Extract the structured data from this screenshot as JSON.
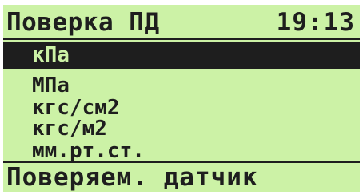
{
  "header": {
    "title": "Поверка ПД",
    "time": "19:13"
  },
  "menu": {
    "items": [
      {
        "label": "кПа",
        "selected": true
      },
      {
        "label": "МПа",
        "selected": false
      },
      {
        "label": "кгс/см2",
        "selected": false
      },
      {
        "label": "кгс/м2",
        "selected": false
      },
      {
        "label": "мм.рт.ст.",
        "selected": false
      }
    ]
  },
  "status": {
    "text": "Поверяем. датчик"
  },
  "colors": {
    "lcd_background": "#ccf2a6",
    "lcd_foreground": "#1e1e1e"
  }
}
